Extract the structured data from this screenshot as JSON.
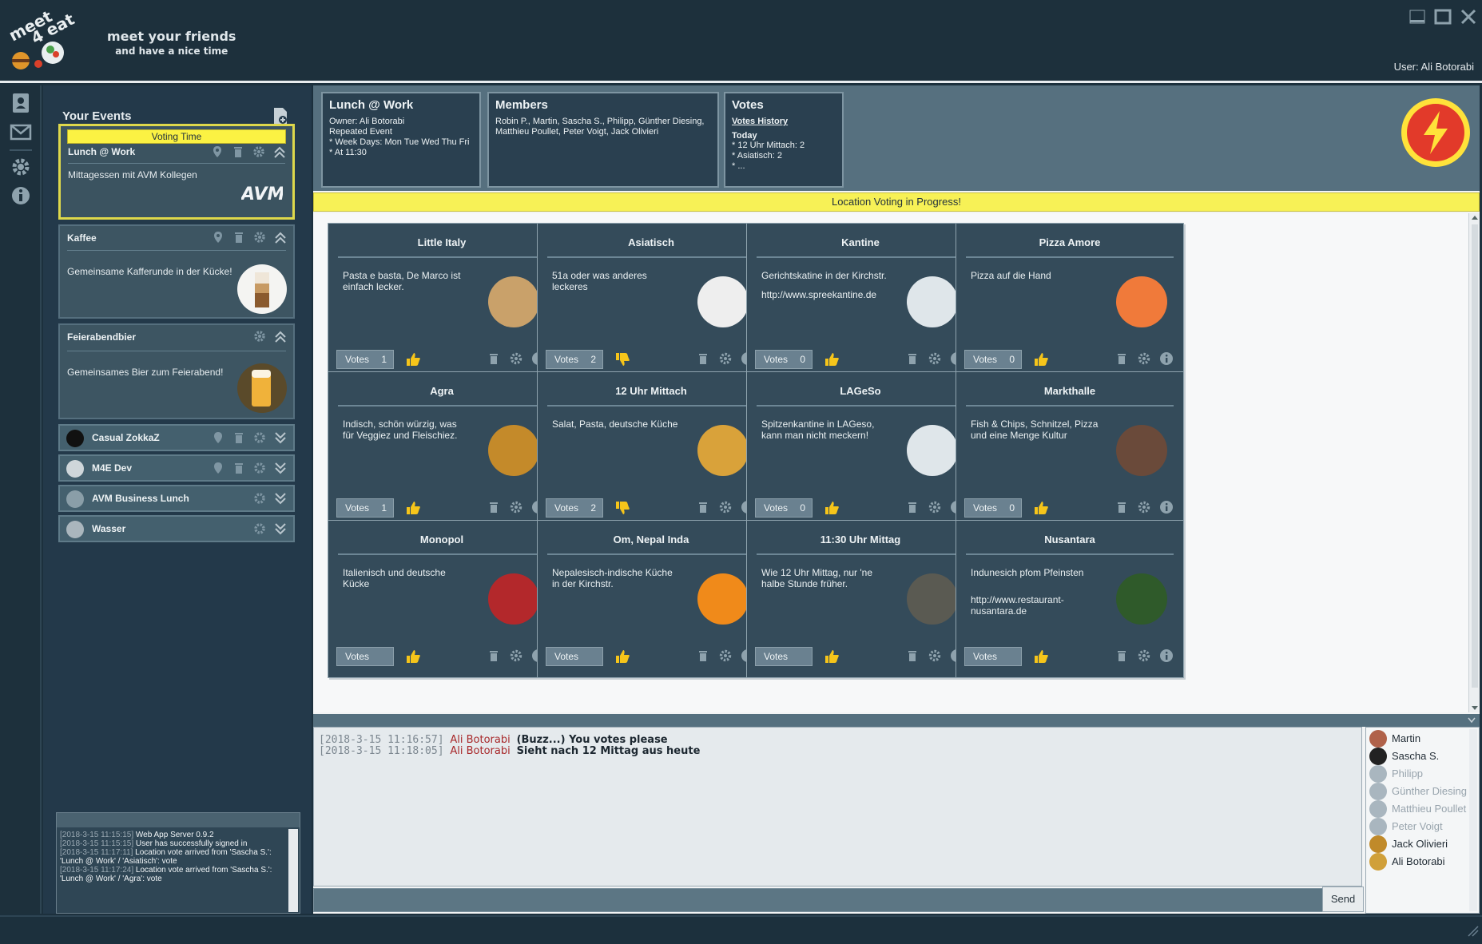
{
  "header": {
    "logo_text": "meet 4 eat",
    "tagline_1": "meet your friends",
    "tagline_2": "and have a nice time",
    "user_label": "User: Ali Botorabi"
  },
  "sidebar": {
    "title": "Your Events",
    "events": [
      {
        "name": "Lunch @ Work",
        "banner": "Voting Time",
        "description": "Mittagessen mit AVM Kollegen",
        "logo": "AVM"
      },
      {
        "name": "Kaffee",
        "description": "Gemeinsame Kafferunde in der Kücke!"
      },
      {
        "name": "Feierabendbier",
        "description": "Gemeinsames Bier zum Feierabend!"
      }
    ],
    "collapsed_events": [
      {
        "name": "Casual ZokkaZ"
      },
      {
        "name": "M4E Dev"
      },
      {
        "name": "AVM Business Lunch"
      },
      {
        "name": "Wasser"
      }
    ]
  },
  "log": [
    {
      "ts": "[2018-3-15 11:15:15]",
      "text": "Web App Server 0.9.2"
    },
    {
      "ts": "[2018-3-15 11:15:15]",
      "text": "User has successfully signed in"
    },
    {
      "ts": "[2018-3-15 11:17:11]",
      "text": "Location vote arrived from 'Sascha S.': 'Lunch @ Work' / 'Asiatisch': vote"
    },
    {
      "ts": "[2018-3-15 11:17:24]",
      "text": "Location vote arrived from 'Sascha S.': 'Lunch @ Work' / 'Agra': vote"
    }
  ],
  "event_info": {
    "title": "Lunch @ Work",
    "owner": "Owner: Ali Botorabi",
    "type": "Repeated Event",
    "week_days": " * Week Days: Mon Tue Wed Thu Fri",
    "at": " * At 11:30"
  },
  "members_info": {
    "title": "Members",
    "names": "Robin P., Martin, Sascha S., Philipp, Günther Diesing, Matthieu Poullet, Peter Voigt, Jack Olivieri"
  },
  "votes_info": {
    "title": "Votes",
    "history_link": "Votes History",
    "today": "Today",
    "line1": "* 12 Uhr Mittach: 2",
    "line2": "* Asiatisch: 2",
    "line3": "* ..."
  },
  "voting_banner": "Location Voting in Progress!",
  "votes_label": "Votes",
  "locations": [
    {
      "name": "Little Italy",
      "description": "Pasta e basta, De Marco ist einfach lecker.",
      "url": "",
      "votes": "1",
      "voted": true,
      "image": "noodles",
      "color": "#c9a16a"
    },
    {
      "name": "Asiatisch",
      "description": "51a oder was anderes leckeres",
      "url": "",
      "votes": "2",
      "voted": false,
      "image": "takeout-box",
      "color": "#eeeeee"
    },
    {
      "name": "Kantine",
      "description": "Gerichtskatine in der Kirchstr.",
      "url": "http://www.spreekantine.de",
      "votes": "0",
      "voted": true,
      "image": "plate",
      "color": "#dfe6ea"
    },
    {
      "name": "Pizza Amore",
      "description": "Pizza auf die Hand",
      "url": "",
      "votes": "0",
      "voted": true,
      "image": "pizza-slice",
      "color": "#f07a3a"
    },
    {
      "name": "Agra",
      "description": "Indisch, schön würzig, was für Veggiez und Fleischiez.",
      "url": "",
      "votes": "1",
      "voted": true,
      "image": "curry",
      "color": "#c48a2a"
    },
    {
      "name": "12 Uhr Mittach",
      "description": "Salat, Pasta, deutsche Küche",
      "url": "",
      "votes": "2",
      "voted": false,
      "image": "dumplings",
      "color": "#d9a23a"
    },
    {
      "name": "LAGeSo",
      "description": "Spitzenkantine in LAGeso, kann man nicht meckern!",
      "url": "",
      "votes": "0",
      "voted": true,
      "image": "plate",
      "color": "#dfe6ea"
    },
    {
      "name": "Markthalle",
      "description": "Fish & Chips, Schnitzel, Pizza und eine Menge Kultur",
      "url": "",
      "votes": "0",
      "voted": true,
      "image": "hall",
      "color": "#6a4a3a"
    },
    {
      "name": "Monopol",
      "description": "Italienisch und deutsche Kücke",
      "url": "",
      "votes": "",
      "voted": true,
      "image": "storefront",
      "color": "#b3282b"
    },
    {
      "name": "Om, Nepal Inda",
      "description": "Nepalesisch-indische Küche in der Kirchstr.",
      "url": "",
      "votes": "",
      "voted": true,
      "image": "om-logo",
      "color": "#f08a1a"
    },
    {
      "name": "11:30 Uhr Mittag",
      "description": "Wie 12 Uhr Mittag, nur 'ne halbe Stunde früher.",
      "url": "",
      "votes": "",
      "voted": true,
      "image": "restaurant",
      "color": "#5a5a52"
    },
    {
      "name": "Nusantara",
      "description": "Indunesich pfom Pfeinsten",
      "url": "http://www.restaurant-nusantara.de",
      "votes": "",
      "voted": true,
      "image": "nusantara-logo",
      "color": "#2f5a2a"
    }
  ],
  "chat": [
    {
      "ts": "[2018-3-15 11:16:57]",
      "who": "Ali Botorabi",
      "msg": "(Buzz...) You votes please"
    },
    {
      "ts": "[2018-3-15 11:18:05]",
      "who": "Ali Botorabi",
      "msg": "Sieht nach 12 Mittag aus heute"
    }
  ],
  "send_label": "Send",
  "online_members": [
    {
      "name": "Martin",
      "online": true,
      "color": "#b0624a"
    },
    {
      "name": "Sascha S.",
      "online": true,
      "color": "#222222"
    },
    {
      "name": "Philipp",
      "online": false,
      "color": "#a9b6bf"
    },
    {
      "name": "Günther Diesing",
      "online": false,
      "color": "#a9b6bf"
    },
    {
      "name": "Matthieu Poullet",
      "online": false,
      "color": "#a9b6bf"
    },
    {
      "name": "Peter Voigt",
      "online": false,
      "color": "#a9b6bf"
    },
    {
      "name": "Jack Olivieri",
      "online": true,
      "color": "#c08a2a"
    },
    {
      "name": "Ali Botorabi",
      "online": true,
      "color": "#d0a03a"
    }
  ]
}
